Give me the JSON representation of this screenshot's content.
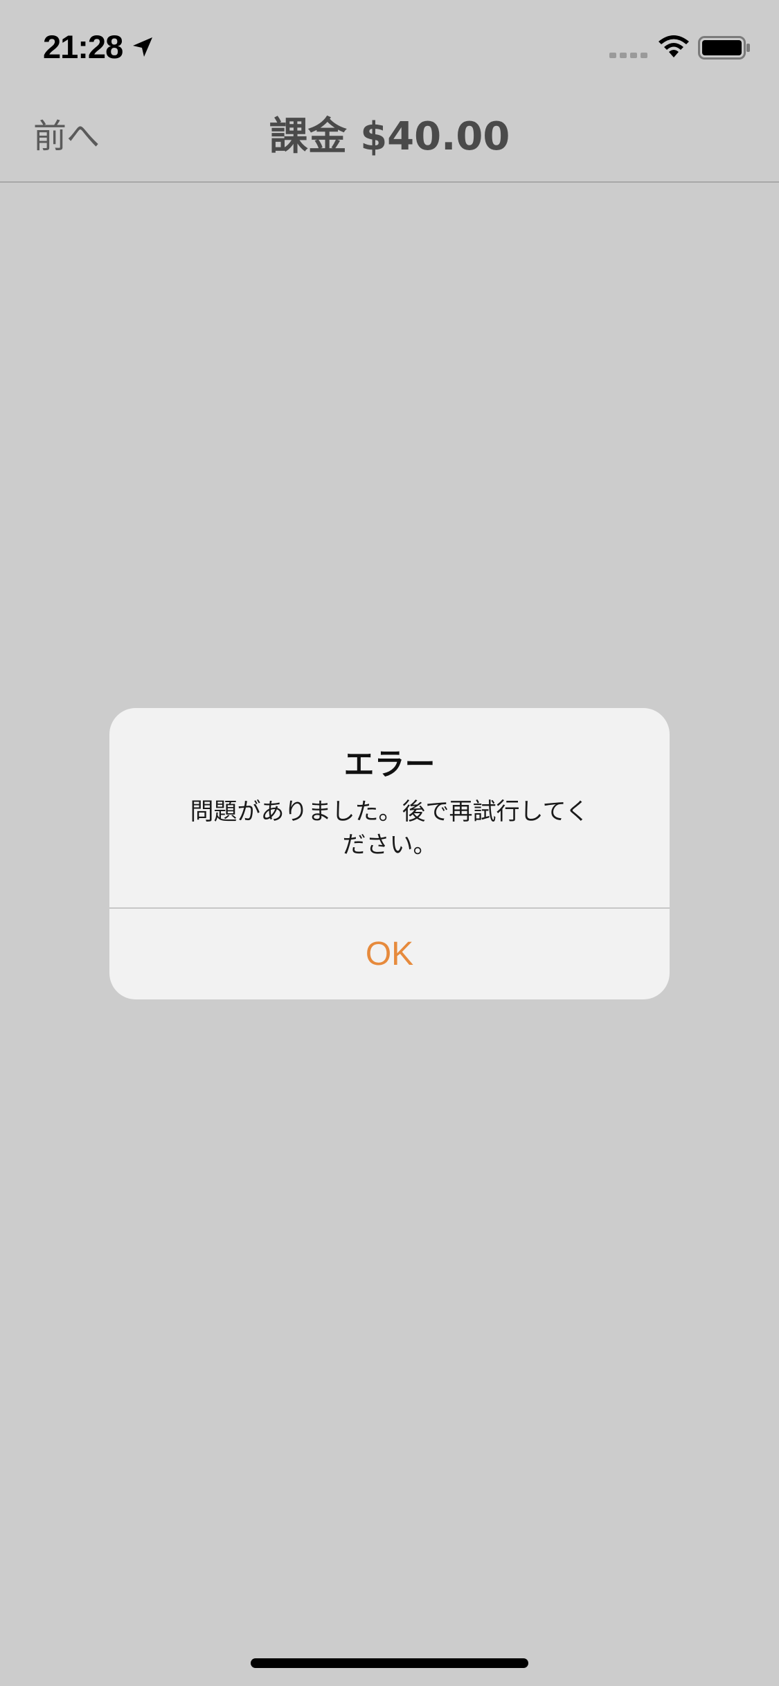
{
  "status_bar": {
    "time": "21:28",
    "icons": [
      "location-arrow-icon",
      "cellular-signal-icon",
      "wifi-icon",
      "battery-icon"
    ]
  },
  "nav": {
    "back_label": "前へ",
    "title": "課金 $40.00"
  },
  "alert": {
    "title": "エラー",
    "message": "問題がありました。後で再試行してください。",
    "ok_label": "OK"
  },
  "colors": {
    "background": "#cccccc",
    "accent": "#e68a3c",
    "nav_title": "#4a4a4a",
    "alert_background": "#f2f2f2"
  }
}
